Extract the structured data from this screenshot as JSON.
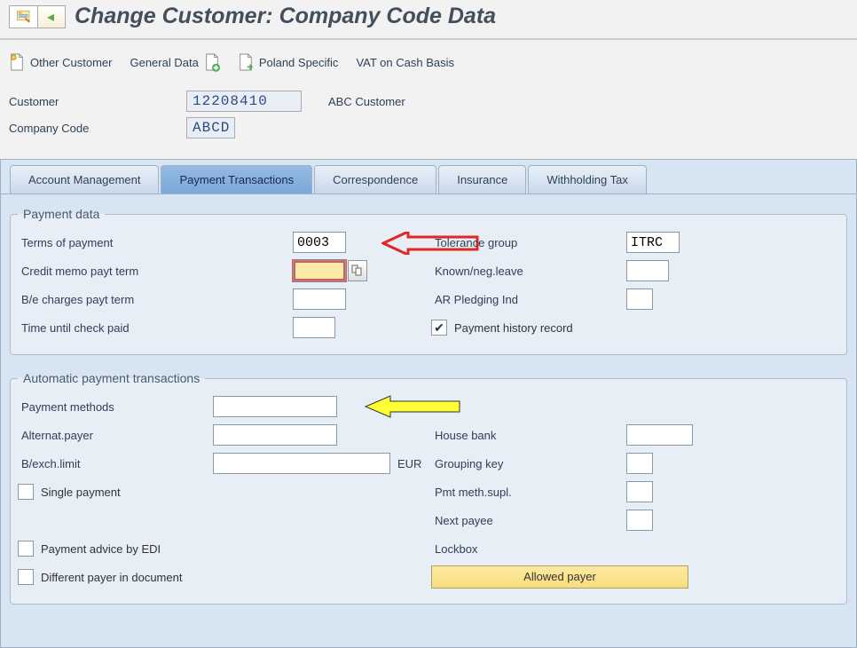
{
  "title": "Change Customer: Company Code Data",
  "toolbar": {
    "other_customer": "Other Customer",
    "general_data": "General Data",
    "poland_specific": "Poland Specific",
    "vat_cash": "VAT on Cash Basis"
  },
  "header": {
    "customer_label": "Customer",
    "customer_value": "12208410",
    "customer_name": "ABC Customer",
    "company_code_label": "Company Code",
    "company_code_value": "ABCD"
  },
  "tabs": {
    "account": "Account Management",
    "payment": "Payment Transactions",
    "correspondence": "Correspondence",
    "insurance": "Insurance",
    "withholding": "Withholding Tax"
  },
  "payment_data": {
    "legend": "Payment data",
    "terms_label": "Terms of payment",
    "terms_value": "0003",
    "credit_memo_label": "Credit memo payt term",
    "credit_memo_value": "",
    "be_charges_label": "B/e charges payt term",
    "be_charges_value": "",
    "time_check_label": "Time until check paid",
    "time_check_value": "",
    "tolerance_label": "Tolerance group",
    "tolerance_value": "ITRC",
    "known_neg_label": "Known/neg.leave",
    "known_neg_value": "",
    "ar_pledge_label": "AR Pledging Ind",
    "ar_pledge_value": "",
    "history_label": "Payment history record"
  },
  "auto_pay": {
    "legend": "Automatic payment transactions",
    "methods_label": "Payment methods",
    "methods_value": "",
    "alt_payer_label": "Alternat.payer",
    "alt_payer_value": "",
    "bexch_label": "B/exch.limit",
    "bexch_value": "",
    "bexch_unit": "EUR",
    "single_label": "Single payment",
    "advice_label": "Payment advice by EDI",
    "diff_payer_label": "Different payer in document",
    "house_bank_label": "House bank",
    "house_bank_value": "",
    "grouping_label": "Grouping key",
    "grouping_value": "",
    "pmt_supl_label": "Pmt meth.supl.",
    "pmt_supl_value": "",
    "next_payee_label": "Next payee",
    "next_payee_value": "",
    "lockbox_label": "Lockbox",
    "allowed_payer_btn": "Allowed payer"
  }
}
